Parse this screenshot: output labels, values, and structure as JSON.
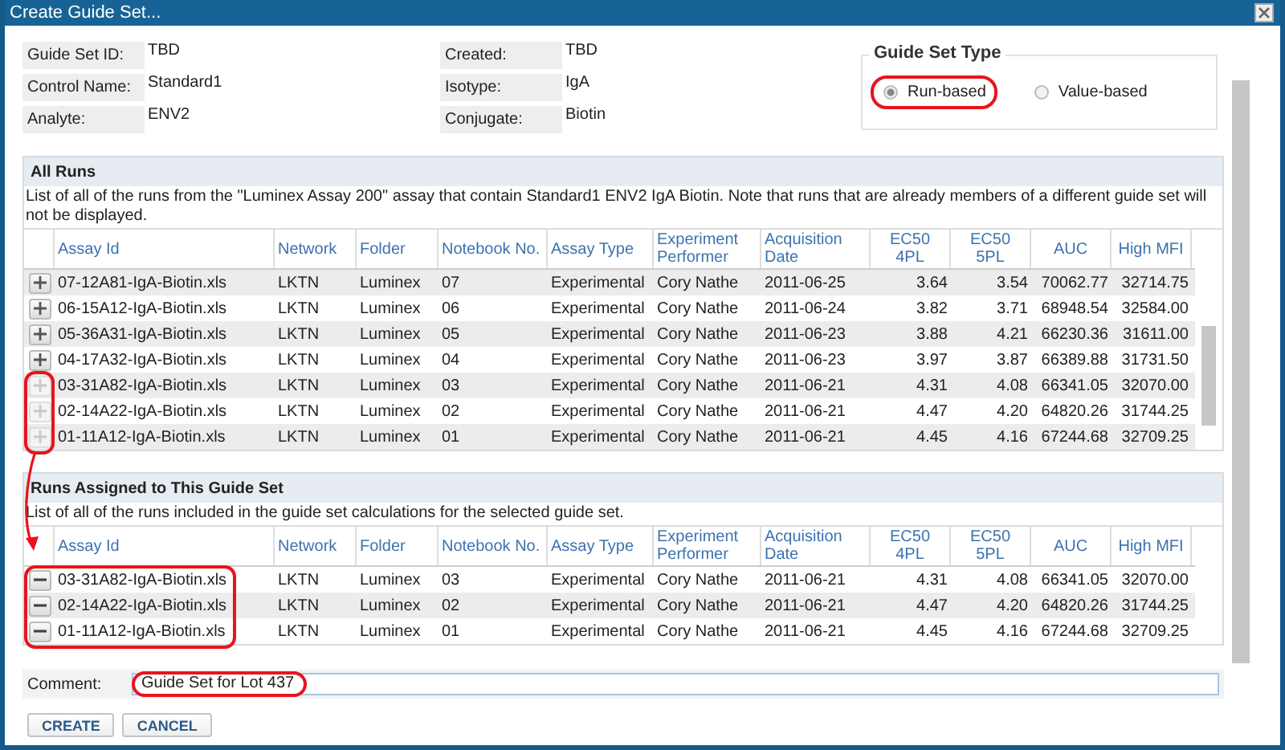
{
  "window": {
    "title": "Create Guide Set..."
  },
  "info_left": [
    {
      "label": "Guide Set ID:",
      "value": "TBD"
    },
    {
      "label": "Control Name:",
      "value": "Standard1"
    },
    {
      "label": "Analyte:",
      "value": "ENV2"
    }
  ],
  "info_right": [
    {
      "label": "Created:",
      "value": "TBD"
    },
    {
      "label": "Isotype:",
      "value": "IgA"
    },
    {
      "label": "Conjugate:",
      "value": "Biotin"
    }
  ],
  "guide_set_type": {
    "legend": "Guide Set Type",
    "options": [
      {
        "label": "Run-based",
        "selected": true
      },
      {
        "label": "Value-based",
        "selected": false
      }
    ]
  },
  "all_runs": {
    "title": "All Runs",
    "columns": [
      "Assay Id",
      "Network",
      "Folder",
      "Notebook No.",
      "Assay Type",
      "Experiment Performer",
      "Acquisition Date",
      "EC50 4PL",
      "EC50 5PL",
      "AUC",
      "High MFI"
    ],
    "description": "List of all of the runs from the \"Luminex Assay 200\" assay that contain Standard1 ENV2 IgA Biotin. Note that runs that are already members of a different guide set will not be displayed.",
    "rows": [
      {
        "disabled": false,
        "cells": [
          "07-12A81-IgA-Biotin.xls",
          "LKTN",
          "Luminex",
          "07",
          "Experimental",
          "Cory Nathe",
          "2011-06-25",
          "3.64",
          "3.54",
          "70062.77",
          "32714.75"
        ]
      },
      {
        "disabled": false,
        "cells": [
          "06-15A12-IgA-Biotin.xls",
          "LKTN",
          "Luminex",
          "06",
          "Experimental",
          "Cory Nathe",
          "2011-06-24",
          "3.82",
          "3.71",
          "68948.54",
          "32584.00"
        ]
      },
      {
        "disabled": false,
        "cells": [
          "05-36A31-IgA-Biotin.xls",
          "LKTN",
          "Luminex",
          "05",
          "Experimental",
          "Cory Nathe",
          "2011-06-23",
          "3.88",
          "4.21",
          "66230.36",
          "31611.00"
        ]
      },
      {
        "disabled": false,
        "cells": [
          "04-17A32-IgA-Biotin.xls",
          "LKTN",
          "Luminex",
          "04",
          "Experimental",
          "Cory Nathe",
          "2011-06-23",
          "3.97",
          "3.87",
          "66389.88",
          "31731.50"
        ]
      },
      {
        "disabled": true,
        "cells": [
          "03-31A82-IgA-Biotin.xls",
          "LKTN",
          "Luminex",
          "03",
          "Experimental",
          "Cory Nathe",
          "2011-06-21",
          "4.31",
          "4.08",
          "66341.05",
          "32070.00"
        ]
      },
      {
        "disabled": true,
        "cells": [
          "02-14A22-IgA-Biotin.xls",
          "LKTN",
          "Luminex",
          "02",
          "Experimental",
          "Cory Nathe",
          "2011-06-21",
          "4.47",
          "4.20",
          "64820.26",
          "31744.25"
        ]
      },
      {
        "disabled": true,
        "cells": [
          "01-11A12-IgA-Biotin.xls",
          "LKTN",
          "Luminex",
          "01",
          "Experimental",
          "Cory Nathe",
          "2011-06-21",
          "4.45",
          "4.16",
          "67244.68",
          "32709.25"
        ]
      }
    ]
  },
  "assigned_runs": {
    "title": "Runs Assigned to This Guide Set",
    "columns": [
      "Assay Id",
      "Network",
      "Folder",
      "Notebook No.",
      "Assay Type",
      "Experiment Performer",
      "Acquisition Date",
      "EC50 4PL",
      "EC50 5PL",
      "AUC",
      "High MFI"
    ],
    "description": "List of all of the runs included in the guide set calculations for the selected guide set.",
    "rows": [
      {
        "cells": [
          "03-31A82-IgA-Biotin.xls",
          "LKTN",
          "Luminex",
          "03",
          "Experimental",
          "Cory Nathe",
          "2011-06-21",
          "4.31",
          "4.08",
          "66341.05",
          "32070.00"
        ]
      },
      {
        "cells": [
          "02-14A22-IgA-Biotin.xls",
          "LKTN",
          "Luminex",
          "02",
          "Experimental",
          "Cory Nathe",
          "2011-06-21",
          "4.47",
          "4.20",
          "64820.26",
          "31744.25"
        ]
      },
      {
        "cells": [
          "01-11A12-IgA-Biotin.xls",
          "LKTN",
          "Luminex",
          "01",
          "Experimental",
          "Cory Nathe",
          "2011-06-21",
          "4.45",
          "4.16",
          "67244.68",
          "32709.25"
        ]
      }
    ]
  },
  "comment": {
    "label": "Comment:",
    "value": "Guide Set for Lot 437"
  },
  "buttons": [
    "CREATE",
    "CANCEL"
  ]
}
